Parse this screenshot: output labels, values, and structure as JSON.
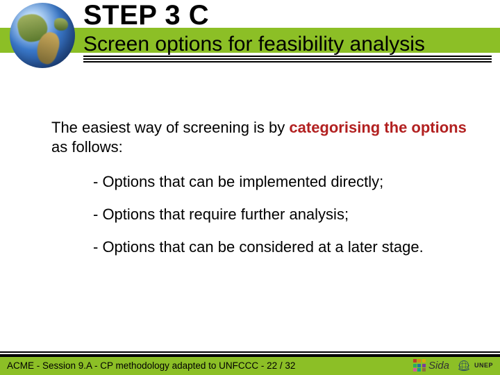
{
  "header": {
    "step": "STEP 3 C",
    "subtitle": "Screen options for feasibility analysis"
  },
  "body": {
    "intro_lead": "The easiest way of screening is by ",
    "intro_emphasis": "categorising the options",
    "intro_tail": " as follows:",
    "items": [
      "- Options that can be implemented directly;",
      "- Options that require further analysis;",
      "- Options that can be considered at a later stage."
    ]
  },
  "footer": {
    "text": "ACME - Session 9.A - CP methodology adapted to UNFCCC - 22 / 32",
    "sida_label": "Sida",
    "unep_label": "UNEP"
  }
}
